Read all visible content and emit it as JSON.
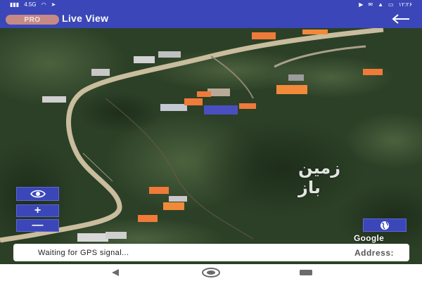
{
  "status_bar": {
    "left_text": "4.5G",
    "time": "۱۲:۲۶"
  },
  "app_bar": {
    "pro_badge": "PRO",
    "title": "Live View",
    "back_icon": "arrow-left-icon"
  },
  "map": {
    "watermark": "زمین باز",
    "controls": {
      "eye_icon": "eye-icon",
      "zoom_in_label": "+",
      "zoom_out_label": "—",
      "location_icon": "globe-icon"
    },
    "attribution": "Google"
  },
  "status_panel": {
    "gps_status": "Waiting for GPS signal...",
    "address_label": "Address:"
  },
  "nav_bar": {
    "back": "back-triangle-icon",
    "home": "home-circle-icon",
    "recents": "recents-square-icon"
  },
  "colors": {
    "primary": "#3b47b8",
    "pro_badge": "#c58a86",
    "roof_orange": "#f07a3a",
    "road": "#c9bd9e",
    "forest": "#2c4027"
  }
}
